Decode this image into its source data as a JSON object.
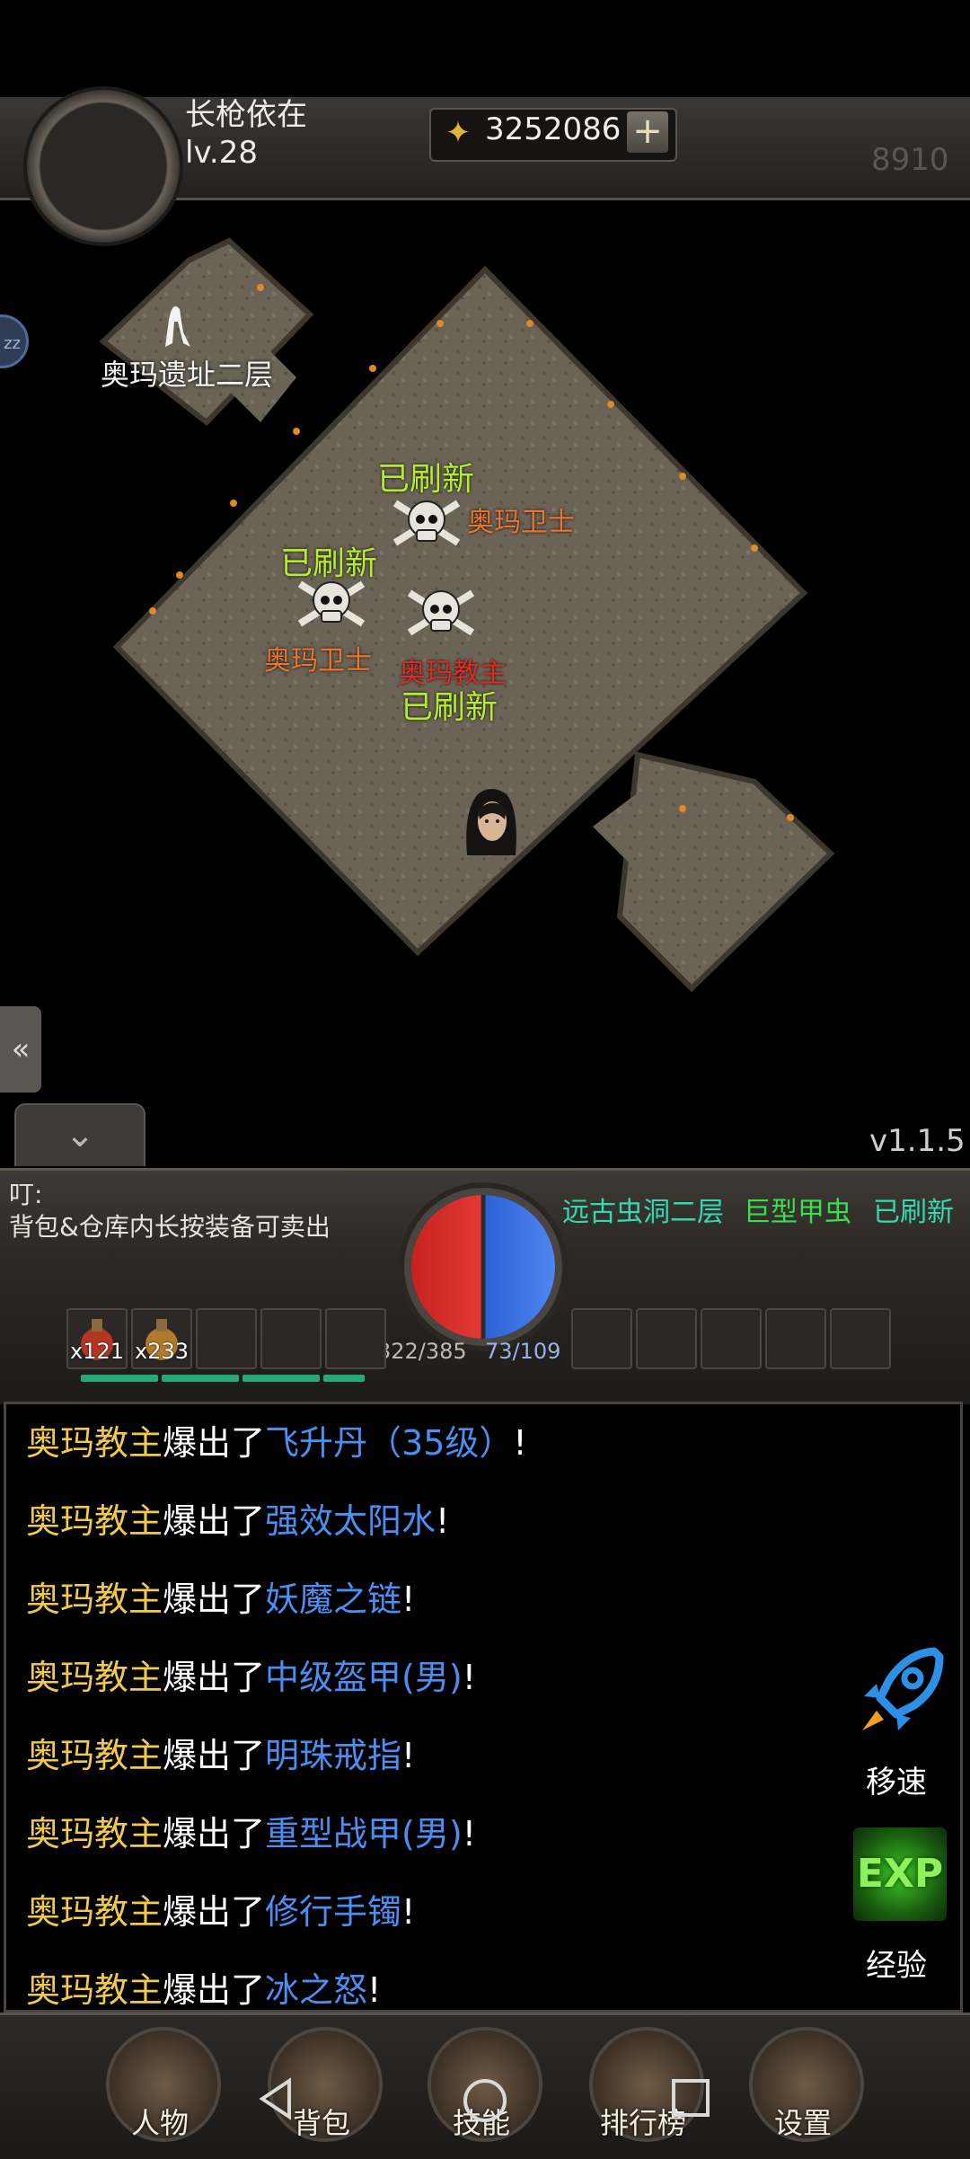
{
  "player": {
    "name": "长枪依在",
    "level": "lv.28"
  },
  "gold": {
    "amount": "3252086",
    "plus": "+"
  },
  "fps": "8910",
  "side_bubble": "zz",
  "map": {
    "exit_label": "奥玛遗址二层",
    "refresh_labels": [
      "已刷新",
      "已刷新",
      "已刷新"
    ],
    "monsters": [
      "奥玛卫士",
      "奥玛卫士",
      "奥玛教主"
    ]
  },
  "left_tab": "«",
  "collapse_tab": "⌄",
  "version": "v1.1.5",
  "notice": {
    "title": "叮:",
    "text": "背包&仓库内长按装备可卖出"
  },
  "refresh_banner": {
    "location": "远古虫洞二层",
    "monster": "巨型甲虫",
    "status": "已刷新"
  },
  "stats": {
    "hp": "322/385",
    "mp": "73/109"
  },
  "quick_slots": [
    {
      "count": "x121"
    },
    {
      "count": "x233"
    }
  ],
  "chat": [
    {
      "who": "奥玛教主",
      "verb": "爆出了",
      "item": "飞升丹（35级）",
      "end": "!"
    },
    {
      "who": "奥玛教主",
      "verb": "爆出了",
      "item": "强效太阳水",
      "end": "!"
    },
    {
      "who": "奥玛教主",
      "verb": "爆出了",
      "item": "妖魔之链",
      "end": "!"
    },
    {
      "who": "奥玛教主",
      "verb": "爆出了",
      "item": "中级盔甲(男)",
      "end": "!"
    },
    {
      "who": "奥玛教主",
      "verb": "爆出了",
      "item": "明珠戒指",
      "end": "!"
    },
    {
      "who": "奥玛教主",
      "verb": "爆出了",
      "item": "重型战甲(男)",
      "end": "!"
    },
    {
      "who": "奥玛教主",
      "verb": "爆出了",
      "item": "修行手镯",
      "end": "!"
    },
    {
      "who": "奥玛教主",
      "verb": "爆出了",
      "item": "冰之怒",
      "end": "!"
    }
  ],
  "quick_buttons": {
    "speed": "移速",
    "exp_icon": "EXP",
    "exp": "经验"
  },
  "nav": [
    "人物",
    "背包",
    "技能",
    "排行榜",
    "设置"
  ],
  "colors": {
    "gold_text": "#f1c94b",
    "item_text": "#4b8ef2",
    "refresh_green": "#b6ec2e",
    "monster_orange": "#e9752e",
    "boss_red": "#e12a22"
  }
}
